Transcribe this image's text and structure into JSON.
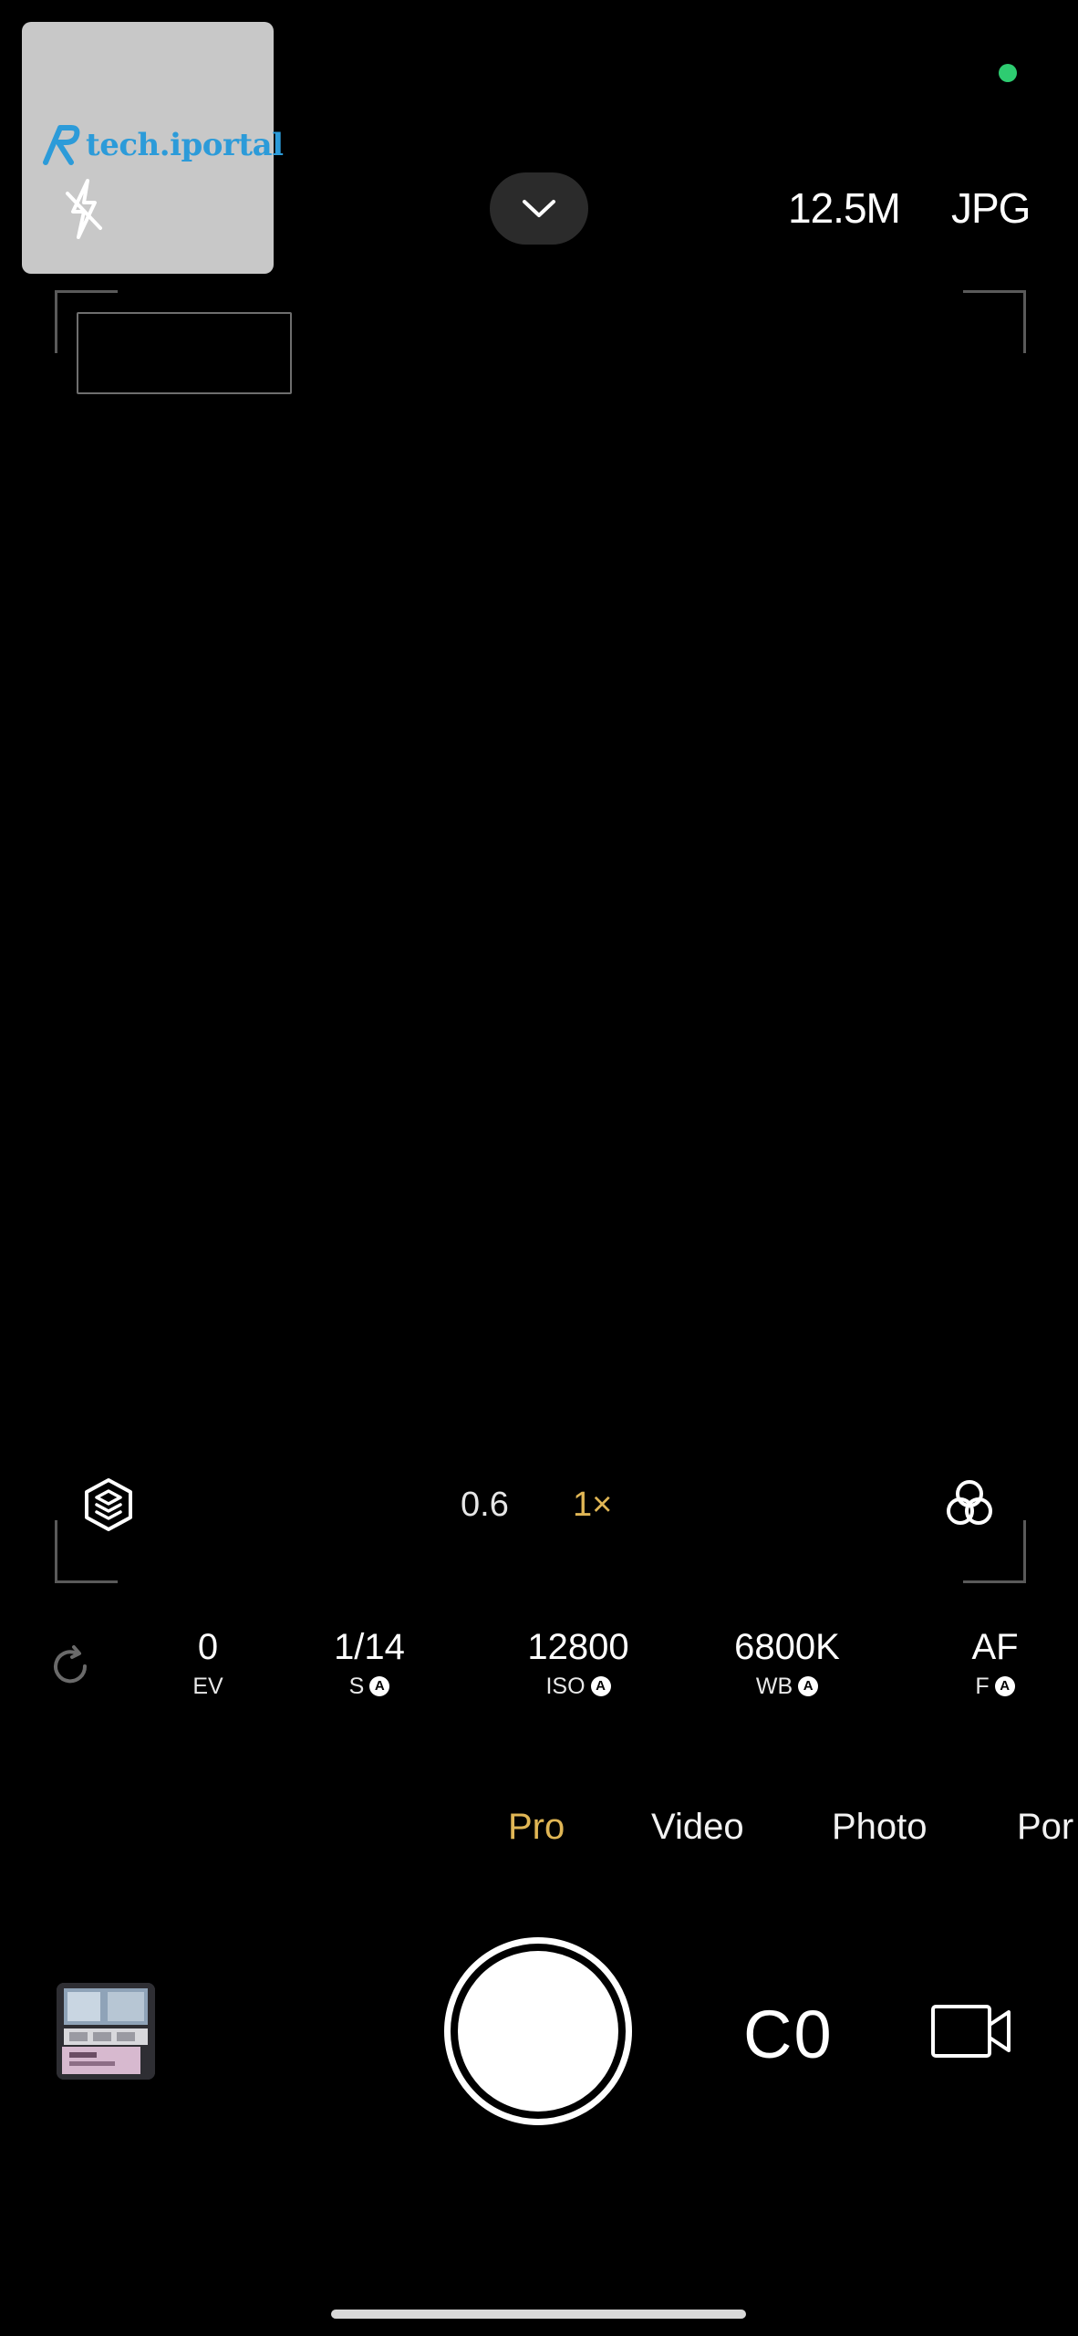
{
  "watermark": {
    "logo_text": "tech.iportal",
    "brand_color": "#2c9bd9",
    "flash_icon": "flash-off-icon"
  },
  "top_bar": {
    "resolution": "12.5M",
    "format": "JPG",
    "collapse_icon": "chevron-down-icon",
    "status_dot_color": "#2ecc71"
  },
  "zoom": {
    "options": [
      "0.6",
      "1×"
    ],
    "selected": "1×",
    "accent_color": "#e0b655",
    "left_icon": "layers-icon",
    "right_icon": "color-filters-icon"
  },
  "pro_params": {
    "reset_icon": "reset-icon",
    "items": [
      {
        "value": "0",
        "label": "EV",
        "auto": ""
      },
      {
        "value": "1/14",
        "label": "S",
        "auto": "A"
      },
      {
        "value": "12800",
        "label": "ISO",
        "auto": "A"
      },
      {
        "value": "6800K",
        "label": "WB",
        "auto": "A"
      },
      {
        "value": "AF",
        "label": "F",
        "auto": "A"
      }
    ]
  },
  "modes": {
    "items": [
      "Pro",
      "Video",
      "Photo",
      "Por"
    ],
    "selected": "Pro"
  },
  "bottom_controls": {
    "gallery_icon": "gallery-thumbnail",
    "shutter_icon": "shutter-button",
    "co_label": "C0",
    "video_icon": "video-camera-icon"
  }
}
